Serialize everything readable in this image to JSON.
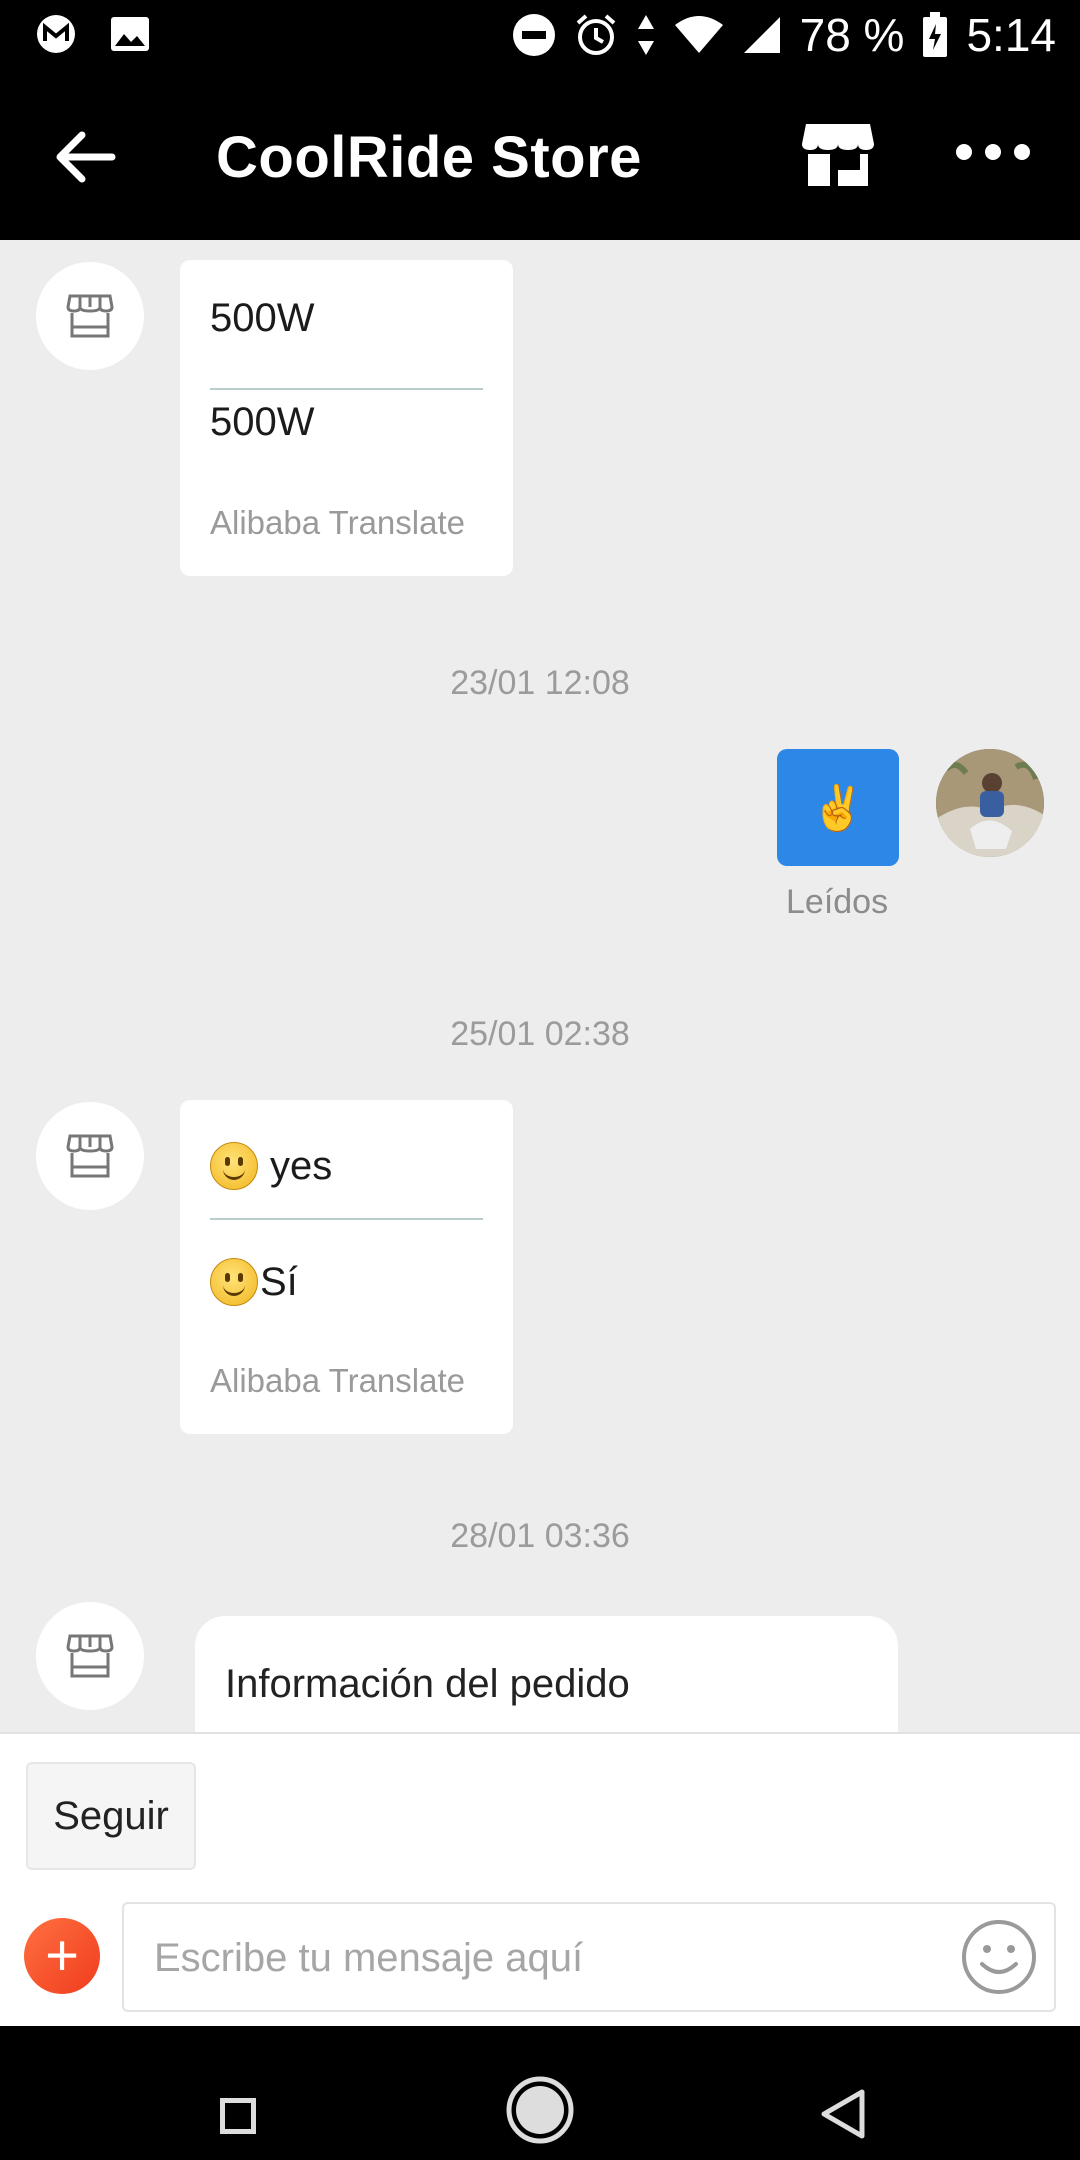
{
  "status_bar": {
    "battery": "78 %",
    "time": "5:14"
  },
  "header": {
    "title": "CoolRide Store"
  },
  "messages": {
    "m1": {
      "original": "500W",
      "translated": "500W",
      "translator": "Alibaba Translate"
    },
    "t1": "23/01 12:08",
    "m2": {
      "emoji": "✌️",
      "status": "Leídos"
    },
    "t2": "25/01 02:38",
    "m3": {
      "original": "yes",
      "translated": "Sí",
      "translator": "Alibaba Translate"
    },
    "t3": "28/01 03:36",
    "m4": {
      "card_title": "Información del pedido"
    }
  },
  "composer": {
    "follow_label": "Seguir",
    "input_placeholder": "Escribe tu mensaje aquí",
    "plus_label": "+"
  },
  "colors": {
    "accent_blue": "#2d87e6",
    "plus_red": "#f03c1e",
    "chat_bg": "#ededed"
  },
  "icons": [
    "gmail-icon",
    "gallery-icon",
    "dnd-icon",
    "alarm-icon",
    "data-arrows-icon",
    "wifi-icon",
    "signal-icon",
    "battery-icon",
    "back-arrow-icon",
    "store-icon",
    "more-icon",
    "store-avatar-icon",
    "emoji-icon",
    "nav-recents-icon",
    "nav-home-icon",
    "nav-back-icon"
  ]
}
